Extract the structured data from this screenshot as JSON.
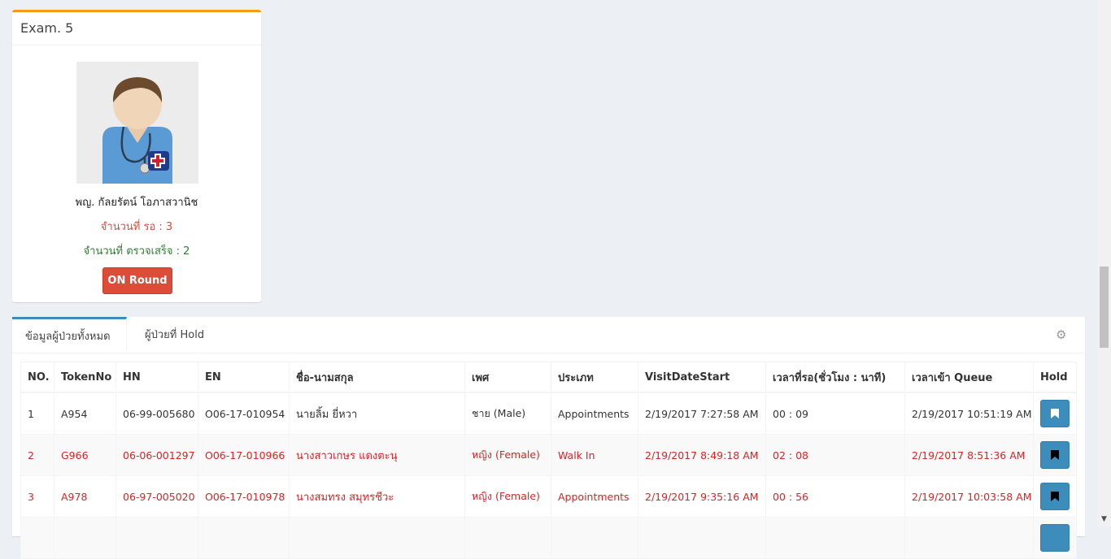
{
  "exam": {
    "title": "Exam. 5",
    "doctor_name": "พญ. กัลยรัตน์ โอภาสวานิช",
    "waiting_label": "จำนวนที่ รอ : 3",
    "done_label": "จำนวนที่ ตรวจเสร็จ : 2",
    "round_button": "ON Round",
    "avatar_icon": "doctor-avatar"
  },
  "tabs": {
    "items": [
      {
        "label": "ข้อมูลผู้ป่วยทั้งหมด",
        "active": true
      },
      {
        "label": "ผู้ป่วยที่ Hold",
        "active": false
      }
    ],
    "settings_icon": "gear-icon"
  },
  "table": {
    "headers": [
      "NO.",
      "TokenNo",
      "HN",
      "EN",
      "ชื่อ-นามสกุล",
      "เพศ",
      "ประเภท",
      "VisitDateStart",
      "เวลาที่รอ(ชั่วโมง : นาที)",
      "เวลาเข้า Queue",
      "Hold"
    ],
    "rows": [
      [
        "1",
        "A954",
        "06-99-005680",
        "O06-17-010954",
        "นายลิ้ม ยี่หวา",
        "ชาย (Male)",
        "Appointments",
        "2/19/2017 7:27:58 AM",
        "00 : 09",
        "2/19/2017 10:51:19 AM"
      ],
      [
        "2",
        "G966",
        "06-06-001297",
        "O06-17-010966",
        "นางสาวเกษร แดงตะนุ",
        "หญิง (Female)",
        "Walk In",
        "2/19/2017 8:49:18 AM",
        "02 : 08",
        "2/19/2017 8:51:36 AM"
      ],
      [
        "3",
        "A978",
        "06-97-005020",
        "O06-17-010978",
        "นางสมทรง สมุทรชีวะ",
        "หญิง (Female)",
        "Appointments",
        "2/19/2017 9:35:16 AM",
        "00 : 56",
        "2/19/2017 10:03:58 AM"
      ],
      [
        "",
        "",
        "",
        "",
        "",
        "",
        "",
        "",
        "",
        ""
      ]
    ],
    "hold_icon": "bookmark-icon"
  },
  "colors": {
    "accent": "#3c8dbc",
    "danger": "#dd4b39",
    "warning_border": "#f39c12",
    "success_text": "#2e7d32"
  }
}
